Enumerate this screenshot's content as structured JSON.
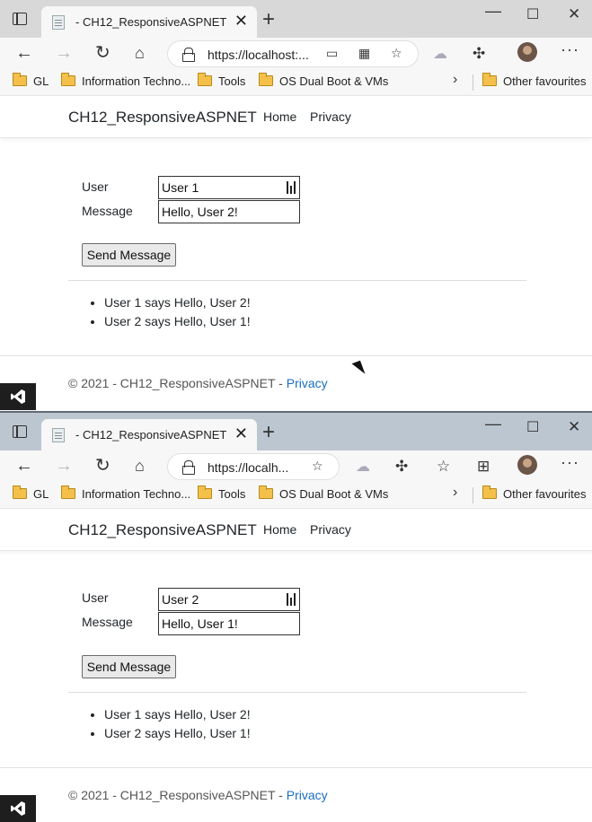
{
  "colors": {
    "link": "#1b6ec2",
    "vs_badge": "#1e1e1e",
    "titlebar_active": "#d8d8d8",
    "titlebar_inactive": "#bcc6d0"
  },
  "windows": [
    {
      "tab_title": "- CH12_ResponsiveASPNET",
      "url": "https://localhost:...",
      "bookmarks": [
        "GL",
        "Information Techno...",
        "Tools",
        "OS Dual Boot & VMs",
        "Other favourites"
      ],
      "brand": "CH12_ResponsiveASPNET",
      "nav": [
        "Home",
        "Privacy"
      ],
      "form": {
        "user_label": "User",
        "message_label": "Message",
        "user_value": "User 1",
        "message_value": "Hello, User 2!",
        "send_label": "Send Message"
      },
      "messages": [
        "User 1 says Hello, User 2!",
        "User 2 says Hello, User 1!"
      ],
      "footer": {
        "text": "© 2021 - CH12_ResponsiveASPNET - ",
        "link": "Privacy"
      }
    },
    {
      "tab_title": "- CH12_ResponsiveASPNET",
      "url": "https://localh...",
      "bookmarks": [
        "GL",
        "Information Techno...",
        "Tools",
        "OS Dual Boot & VMs",
        "Other favourites"
      ],
      "brand": "CH12_ResponsiveASPNET",
      "nav": [
        "Home",
        "Privacy"
      ],
      "form": {
        "user_label": "User",
        "message_label": "Message",
        "user_value": "User 2",
        "message_value": "Hello, User 1!",
        "send_label": "Send Message"
      },
      "messages": [
        "User 1 says Hello, User 2!",
        "User 2 says Hello, User 1!"
      ],
      "footer": {
        "text": "© 2021 - CH12_ResponsiveASPNET - ",
        "link": "Privacy"
      }
    }
  ]
}
